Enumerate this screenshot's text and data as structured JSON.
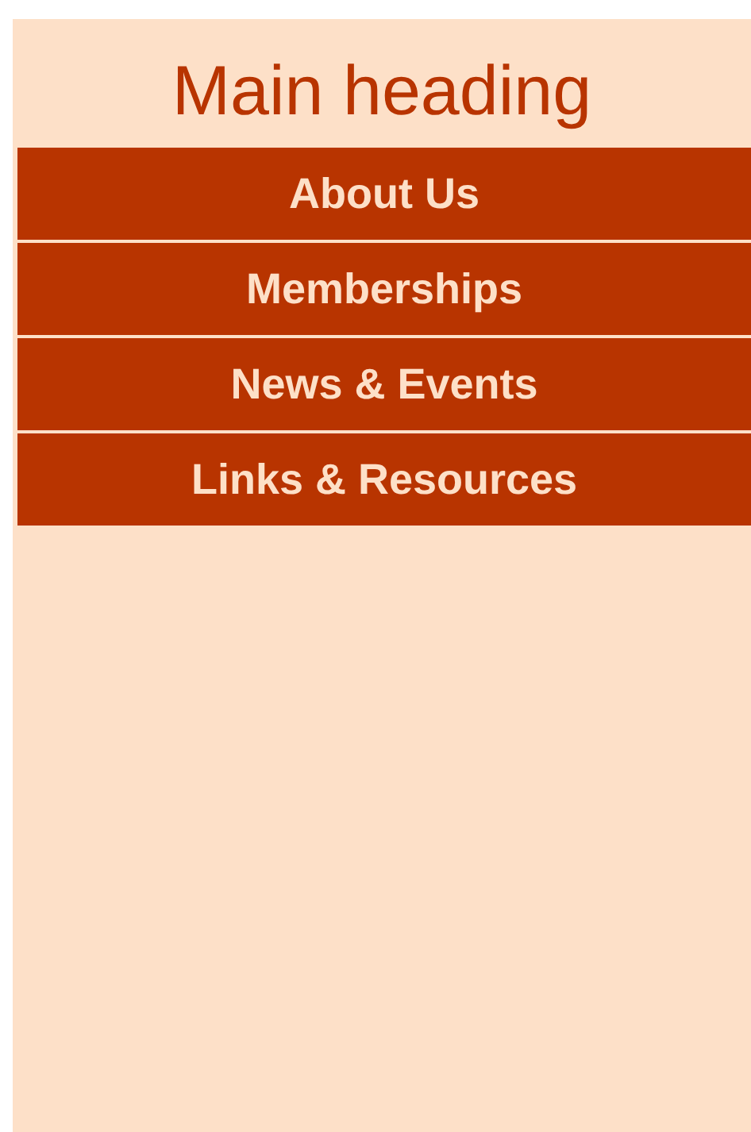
{
  "heading": "Main heading",
  "nav": [
    {
      "label": "About Us"
    },
    {
      "label": "Memberships"
    },
    {
      "label": "News & Events"
    },
    {
      "label": "Links & Resources"
    }
  ]
}
